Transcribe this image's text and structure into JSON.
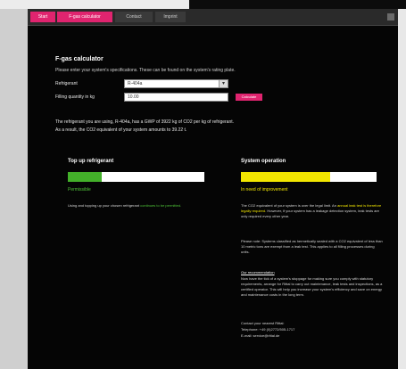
{
  "nav": {
    "tabs": [
      {
        "label": "Start"
      },
      {
        "label": "F-gas calculator"
      },
      {
        "label": "Contact"
      },
      {
        "label": "Imprint"
      }
    ],
    "right_label": "EN"
  },
  "calculator": {
    "title": "F-gas calculator",
    "intro": "Please enter your system's specifications. These can be found on the system's rating plate.",
    "refrigerant_label": "Refrigerant",
    "refrigerant_value": "R-404a",
    "capacity_label": "Filling quantity in kg",
    "capacity_value": "10.00",
    "calculate_label": "Calculate",
    "result_line1": "The refrigerant you are using, R-404a, has a GWP of 3922 kg of CO2 per kg of refrigerant.",
    "result_line2": "As a result, the CO2 equivalent of your system amounts to 39.22 t."
  },
  "topup": {
    "heading": "Top up refrigerant",
    "fill_fraction": 0.25,
    "color": "#43b02a",
    "status": "Permissible",
    "text_prefix": "Using and topping up your chosen refrigerant",
    "text_link": "continues to be permitted."
  },
  "operation": {
    "heading": "System operation",
    "fill_fraction": 0.66,
    "color": "#f2e600",
    "status": "In need of improvement",
    "para1_a": "The CO2 equivalent of your system is over the legal limit. An",
    "para1_warn": "annual leak test is therefore legally required.",
    "para1_b": "However, if your system has a leakage detection system, leak tests are only required every other year.",
    "para2": "Please note: Systems classified as hermetically sealed with a CO2 equivalent of less than 10 metric tons are exempt from a leak test. This applies to all filling processes during units.",
    "recommendation_heading": "Our recommendation",
    "recommendation_text": "Now have the tick of a system's stoppage for making sure you comply with statutory requirements, arrange for Rittal to carry out maintenance, leak tests and inspections, as a certified operator. This will help you increase your system's efficiency and save on energy and maintenance costs in the long term.",
    "contact_intro": "Contact your nearest Rittal:",
    "telephone": "Telephone: +49 (0)2772/505-1717",
    "email": "E-mail: service@rittal.de"
  }
}
